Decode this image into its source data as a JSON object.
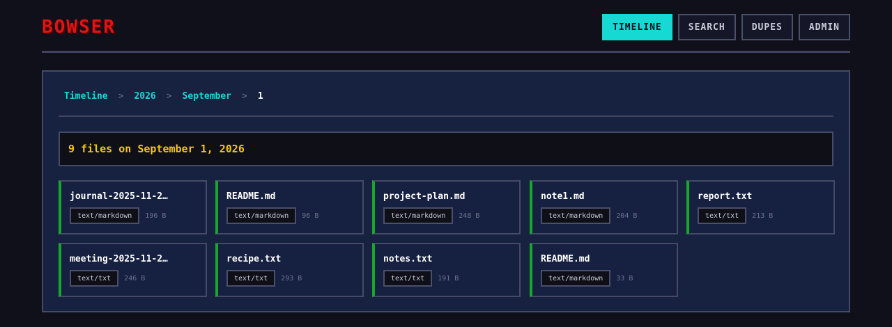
{
  "app": {
    "logo": "BOWSER"
  },
  "nav": [
    {
      "label": "TIMELINE",
      "active": true
    },
    {
      "label": "SEARCH",
      "active": false
    },
    {
      "label": "DUPES",
      "active": false
    },
    {
      "label": "ADMIN",
      "active": false
    }
  ],
  "breadcrumb": {
    "items": [
      "Timeline",
      "2026",
      "September"
    ],
    "separator": ">",
    "current": "1"
  },
  "summary": "9 files on September 1, 2026",
  "files": [
    {
      "name": "journal-2025-11-2…",
      "type": "text/markdown",
      "size": "196 B"
    },
    {
      "name": "README.md",
      "type": "text/markdown",
      "size": "96 B"
    },
    {
      "name": "project-plan.md",
      "type": "text/markdown",
      "size": "248 B"
    },
    {
      "name": "note1.md",
      "type": "text/markdown",
      "size": "204 B"
    },
    {
      "name": "report.txt",
      "type": "text/txt",
      "size": "213 B"
    },
    {
      "name": "meeting-2025-11-2…",
      "type": "text/txt",
      "size": "246 B"
    },
    {
      "name": "recipe.txt",
      "type": "text/txt",
      "size": "293 B"
    },
    {
      "name": "notes.txt",
      "type": "text/txt",
      "size": "191 B"
    },
    {
      "name": "README.md",
      "type": "text/markdown",
      "size": "33 B"
    }
  ],
  "colors": {
    "accent": "#16d9d3",
    "logo": "#e01414",
    "summary_text": "#f3c614",
    "card_stripe": "#17a82a"
  }
}
